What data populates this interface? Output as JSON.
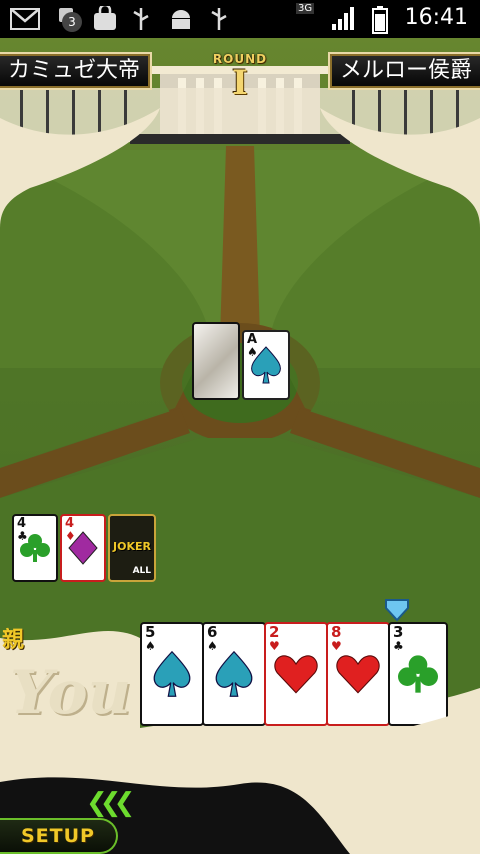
{
  "status_bar": {
    "time": "16:41",
    "notification_count": "3",
    "network": "3G",
    "icons": [
      "gmail-icon",
      "notification-count-icon",
      "bag-icon",
      "usb-icon",
      "android-icon",
      "usb-icon",
      "signal-icon",
      "battery-icon"
    ]
  },
  "header": {
    "opponent_left": "カミュゼ大帝",
    "opponent_right": "メルロー侯爵",
    "round_label": "ROUND",
    "round_number": "I"
  },
  "table": {
    "deck_card": "face-down",
    "played_card": {
      "rank": "A",
      "suit": "♠"
    }
  },
  "left_pile": [
    {
      "rank": "4",
      "suit": "♣",
      "color": "#2aa02a"
    },
    {
      "rank": "4",
      "suit": "♦",
      "color": "#a02aa0"
    },
    {
      "rank": "JOKER",
      "sub": "ALL"
    }
  ],
  "player": {
    "dealer_mark": "親",
    "name": "You",
    "hand": [
      {
        "rank": "5",
        "suit": "♠",
        "color": "#2aa0b8"
      },
      {
        "rank": "6",
        "suit": "♠",
        "color": "#2aa0b8"
      },
      {
        "rank": "2",
        "suit": "♥",
        "color": "#e02020"
      },
      {
        "rank": "8",
        "suit": "♥",
        "color": "#e02020"
      },
      {
        "rank": "3",
        "suit": "♣",
        "color": "#2aa02a"
      }
    ]
  },
  "controls": {
    "setup_label": "SETUP"
  },
  "colors": {
    "grass": "#55782a",
    "path": "#7a5a20",
    "gold": "#f0c828",
    "cream": "#efe6cc"
  }
}
